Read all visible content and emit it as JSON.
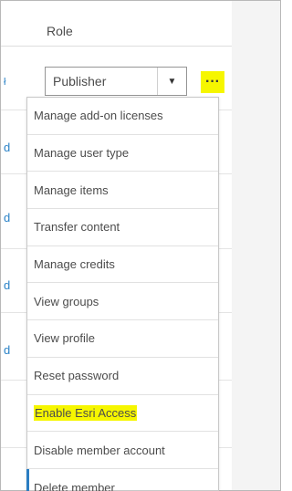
{
  "table": {
    "column_header": "Role",
    "left_link_fragment": "d",
    "role_select": {
      "value": "Publisher"
    }
  },
  "menu": {
    "items": [
      {
        "label": "Manage add-on licenses"
      },
      {
        "label": "Manage user type"
      },
      {
        "label": "Manage items"
      },
      {
        "label": "Transfer content"
      },
      {
        "label": "Manage credits"
      },
      {
        "label": "View groups"
      },
      {
        "label": "View profile"
      },
      {
        "label": "Reset password"
      },
      {
        "label": "Enable Esri Access",
        "highlighted": true
      },
      {
        "label": "Disable member account"
      },
      {
        "label": "Delete member"
      }
    ]
  },
  "icons": {
    "more": "more-horizontal-icon",
    "caret": "caret-down-icon"
  },
  "colors": {
    "highlight": "#f6f600",
    "link": "#2a82c7",
    "active_bar": "#2a7dc2",
    "panel": "#f4f4f4"
  }
}
